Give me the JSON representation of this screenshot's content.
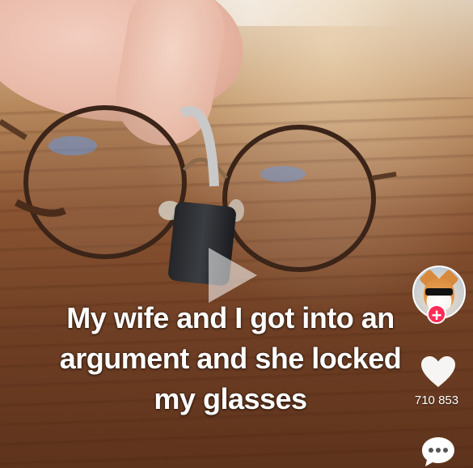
{
  "video": {
    "caption_lines": [
      "My wife and I got into an",
      "argument and she locked",
      "my glasses"
    ]
  },
  "sidebar": {
    "avatar_icon": "cat-avatar-icon",
    "follow_icon": "plus-icon",
    "follow_symbol": "+",
    "like_icon": "heart-icon",
    "like_count": "710 853",
    "comment_icon": "comment-icon"
  },
  "colors": {
    "follow_accent": "#fe2c55",
    "text": "#ffffff"
  }
}
